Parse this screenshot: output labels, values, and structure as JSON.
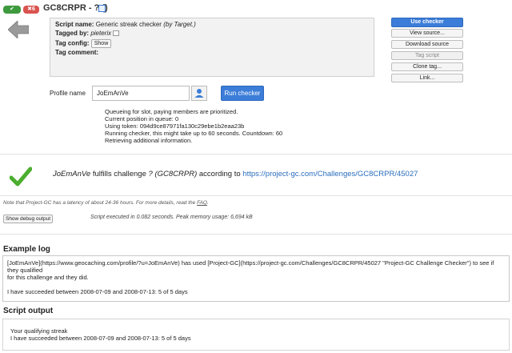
{
  "header": {
    "badge_ok": "✔",
    "badge_fail": "✖6",
    "title": "GC8CRPR - ? ()"
  },
  "info": {
    "script_name_label": "Script name:",
    "script_name": "Generic streak checker",
    "script_author": "(by Target.)",
    "tagged_by_label": "Tagged by:",
    "tagged_by": "pieterix",
    "tag_config_label": "Tag config:",
    "tag_config_button": "Show",
    "tag_comment_label": "Tag comment:"
  },
  "actions": {
    "use_checker": "Use checker",
    "view_source": "View source...",
    "download_source": "Download source",
    "tag_script": "Tag script",
    "clone_tag": "Clone tag...",
    "link": "Link..."
  },
  "profile": {
    "label": "Profile name",
    "value": "JoEmAnVe",
    "run_button": "Run checker"
  },
  "queue_messages": [
    "Queueing for slot, paying members are prioritized.",
    "Current position in queue: 0",
    "Using token: 094d9ce87971fa130c29ebe1b2eaa23b",
    "Running checker, this might take up to 60 seconds. Countdown: 60",
    "Retrieving additional information."
  ],
  "result": {
    "user": "JoEmAnVe",
    "text_mid": "fulfills challenge",
    "challenge": "? (GC8CRPR)",
    "text_according": "according to",
    "url": "https://project-gc.com/Challenges/GC8CRPR/45027"
  },
  "latency_note": {
    "text": "Note that Project-GC has a latency of about 24-36 hours. For more details, read the",
    "faq": "FAQ",
    "dot": "."
  },
  "debug": {
    "button": "Show debug output",
    "executed": "Script executed in 0.082 seconds. Peak memory usage: 6,694 kB"
  },
  "example_log": {
    "heading": "Example log",
    "line1": "[JoEmAnVe](https://www.geocaching.com/profile/?u=JoEmAnVe) has used [Project-GC](https://project-gc.com/Challenges/GC8CRPR/45027 \"Project-GC Challenge Checker\") to see if they qualified",
    "line2": "for this challenge and they did.",
    "line3": "I have succeeded between 2008-07-09 and 2008-07-13: 5 of 5 days"
  },
  "script_output": {
    "heading": "Script output",
    "line1": "Your qualifying streak",
    "line2": "I have succeeded between 2008-07-09 and 2008-07-13: 5 of 5 days"
  },
  "colors": {
    "accent": "#3b7dd8",
    "success": "#3d9a3d",
    "error": "#d9534f",
    "link": "#2a6ebd"
  }
}
